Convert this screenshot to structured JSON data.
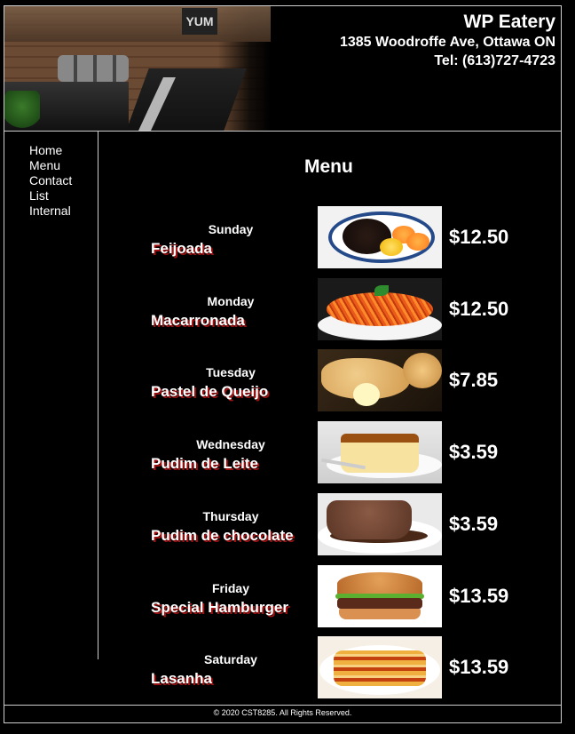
{
  "site": {
    "name": "WP Eatery",
    "address": "1385 Woodroffe Ave, Ottawa ON",
    "phone": "Tel: (613)727-4723",
    "hero_sign": "YUM"
  },
  "nav": {
    "items": [
      "Home",
      "Menu",
      "Contact",
      "List",
      "Internal"
    ]
  },
  "main": {
    "title": "Menu",
    "items": [
      {
        "day": "Sunday",
        "dish": "Feijoada",
        "price": "$12.50"
      },
      {
        "day": "Monday",
        "dish": "Macarronada",
        "price": "$12.50"
      },
      {
        "day": "Tuesday",
        "dish": "Pastel de Queijo",
        "price": "$7.85"
      },
      {
        "day": "Wednesday",
        "dish": "Pudim de Leite",
        "price": "$3.59"
      },
      {
        "day": "Thursday",
        "dish": "Pudim de chocolate",
        "price": "$3.59"
      },
      {
        "day": "Friday",
        "dish": "Special Hamburger",
        "price": "$13.59"
      },
      {
        "day": "Saturday",
        "dish": "Lasanha",
        "price": "$13.59"
      }
    ]
  },
  "footer": {
    "text": "© 2020 CST8285. All Rights Reserved."
  },
  "colors": {
    "background": "#000000",
    "text": "#ffffff",
    "border": "#cfcfcf",
    "dish_shadow": "#a01010"
  }
}
